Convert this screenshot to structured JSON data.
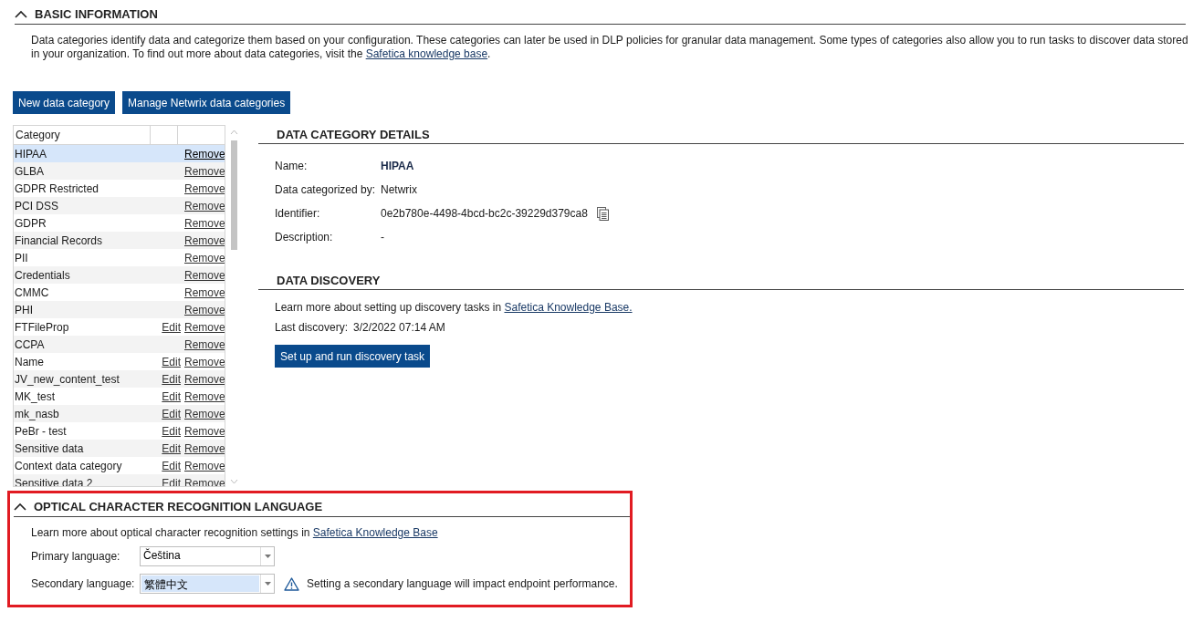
{
  "basic_information": {
    "title": "BASIC INFORMATION",
    "expanded": true,
    "description": [
      "Data categories identify data and categorize them based on your configuration. These categories can later be used in DLP policies for granular data management. Some types of categories also allow you to run tasks to discover data stored in your organization. To find out more about data categories, visit the ",
      "Safetica knowledge base",
      "."
    ],
    "buttons": [
      "New data category",
      "Manage Netwrix data categories"
    ]
  },
  "table": {
    "columns": [
      "Category"
    ],
    "rows": [
      {
        "name": "HIPAA",
        "actions": [
          "Remove"
        ],
        "selected": true
      },
      {
        "name": "GLBA",
        "actions": [
          "Remove"
        ],
        "selected": false
      },
      {
        "name": "GDPR Restricted",
        "actions": [
          "Remove"
        ],
        "selected": false
      },
      {
        "name": "PCI DSS",
        "actions": [
          "Remove"
        ],
        "selected": false
      },
      {
        "name": "GDPR",
        "actions": [
          "Remove"
        ],
        "selected": false
      },
      {
        "name": "Financial Records",
        "actions": [
          "Remove"
        ],
        "selected": false
      },
      {
        "name": "PII",
        "actions": [
          "Remove"
        ],
        "selected": false
      },
      {
        "name": "Credentials",
        "actions": [
          "Remove"
        ],
        "selected": false
      },
      {
        "name": "CMMC",
        "actions": [
          "Remove"
        ],
        "selected": false
      },
      {
        "name": "PHI",
        "actions": [
          "Remove"
        ],
        "selected": false
      },
      {
        "name": "FTFileProp",
        "actions": [
          "Edit",
          "Remove"
        ],
        "selected": false
      },
      {
        "name": "CCPA",
        "actions": [
          "Remove"
        ],
        "selected": false
      },
      {
        "name": "Name",
        "actions": [
          "Edit",
          "Remove"
        ],
        "selected": false
      },
      {
        "name": "JV_new_content_test",
        "actions": [
          "Edit",
          "Remove"
        ],
        "selected": false
      },
      {
        "name": "MK_test",
        "actions": [
          "Edit",
          "Remove"
        ],
        "selected": false
      },
      {
        "name": "mk_nasb",
        "actions": [
          "Edit",
          "Remove"
        ],
        "selected": false
      },
      {
        "name": "PeBr - test",
        "actions": [
          "Edit",
          "Remove"
        ],
        "selected": false
      },
      {
        "name": "Sensitive data",
        "actions": [
          "Edit",
          "Remove"
        ],
        "selected": false
      },
      {
        "name": "Context data category",
        "actions": [
          "Edit",
          "Remove"
        ],
        "selected": false
      },
      {
        "name": "Sensitive data 2",
        "actions": [
          "Edit",
          "Remove"
        ],
        "selected": false
      }
    ]
  },
  "details": {
    "title": "DATA CATEGORY DETAILS",
    "fields": [
      {
        "label": "Name:",
        "value": "HIPAA",
        "kind": "bold"
      },
      {
        "label": "Data categorized by:",
        "value": "Netwrix",
        "kind": "plain"
      },
      {
        "label": "Identifier:",
        "value": "0e2b780e-4498-4bcd-bc2c-39229d379ca8",
        "kind": "copy"
      },
      {
        "label": "Description:",
        "value": "-",
        "kind": "plain"
      }
    ]
  },
  "discovery": {
    "title": "DATA DISCOVERY",
    "text": "Learn more about setting up discovery tasks in ",
    "link": "Safetica Knowledge Base.",
    "last_label": "Last discovery:",
    "last_value": "3/2/2022 07:14 AM",
    "button": "Set up and run discovery task"
  },
  "ocr": {
    "title": "OPTICAL CHARACTER RECOGNITION LANGUAGE",
    "expanded": true,
    "highlighted": true,
    "text": "Learn more about optical character recognition settings in ",
    "link": "Safetica Knowledge Base",
    "fields": [
      {
        "label": "Primary language:",
        "value": "Čeština",
        "selected": false
      },
      {
        "label": "Secondary language:",
        "value": "繁體中文",
        "selected": true,
        "warning": "Setting a secondary language will impact endpoint performance."
      }
    ]
  }
}
